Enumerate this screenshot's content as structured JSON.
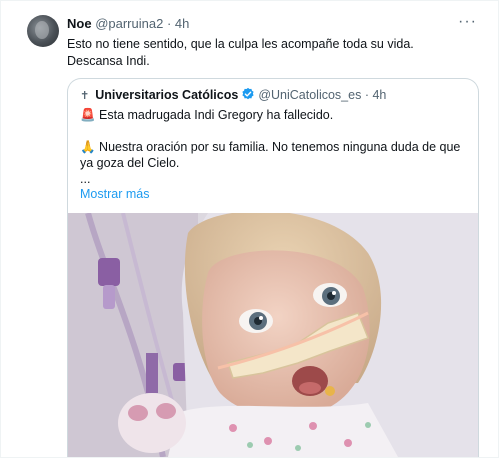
{
  "tweet": {
    "name": "Noe",
    "handle": "@parruina2",
    "sep": "·",
    "time": "4h",
    "more": "···",
    "text_line1": "Esto no tiene sentido, que la culpa les acompañe toda su vida.",
    "text_line2": "Descansa Indi."
  },
  "quote": {
    "cross": "✝",
    "name": "Universitarios Católicos",
    "handle": "@UniCatolicos_es",
    "sep": "·",
    "time": "4h",
    "line1": "🚨 Esta madrugada Indi Gregory ha fallecido.",
    "line2": "🙏 Nuestra oración por su familia. No tenemos ninguna duda de que",
    "line3": "ya goza del Cielo.",
    "ellipsis": "...",
    "show_more": "Mostrar más"
  },
  "colors": {
    "link": "#1d9bf0",
    "muted": "#536471",
    "border": "#cfd9de"
  }
}
